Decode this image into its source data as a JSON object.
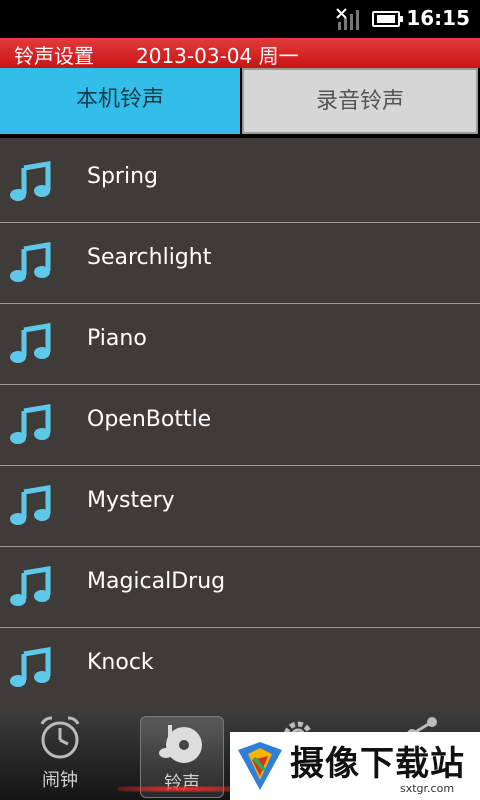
{
  "status_bar": {
    "time": "16:15",
    "signal_icon": "signal-off-icon",
    "battery_icon": "battery-icon"
  },
  "title_bar": {
    "title": "铃声设置",
    "date": "2013-03-04 周一"
  },
  "tabs": [
    {
      "label": "本机铃声",
      "selected": true
    },
    {
      "label": "录音铃声",
      "selected": false
    }
  ],
  "ringtones": [
    {
      "name": "Spring"
    },
    {
      "name": "Searchlight"
    },
    {
      "name": "Piano"
    },
    {
      "name": "OpenBottle"
    },
    {
      "name": "Mystery"
    },
    {
      "name": "MagicalDrug"
    },
    {
      "name": "Knock"
    }
  ],
  "bottom_nav": {
    "alarm_label": "闹钟",
    "ringtone_label": "铃声",
    "active": "铃声"
  },
  "watermark": {
    "text": "摄像下载站",
    "url": "sxtgr.com"
  },
  "colors": {
    "accent_tab": "#33bde9",
    "title_red": "#d61d1d",
    "list_bg": "#3f3b39",
    "note_blue": "#5ec8ea"
  }
}
